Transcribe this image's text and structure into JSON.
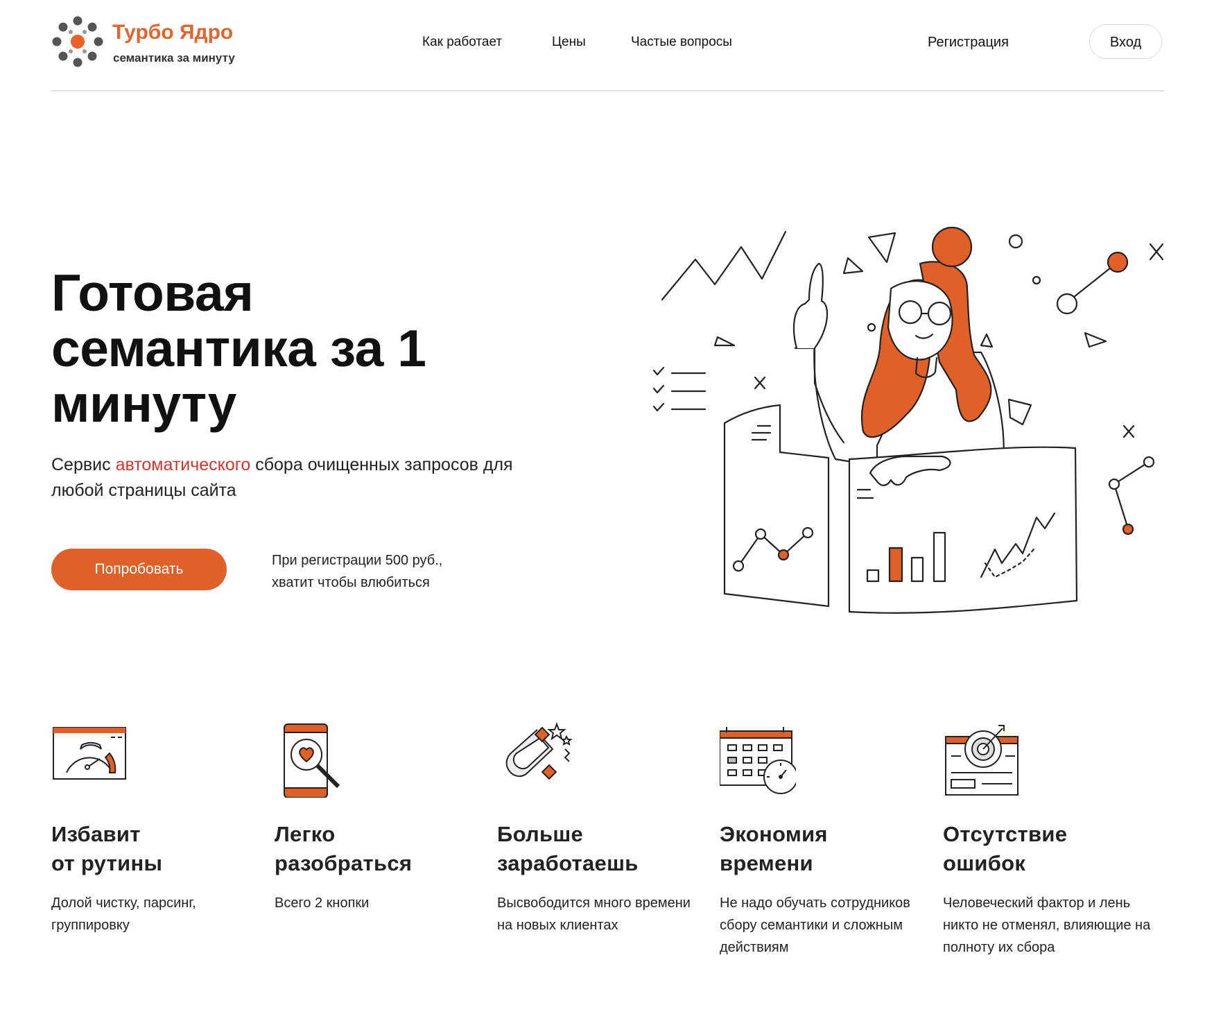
{
  "header": {
    "logo_title": "Турбо Ядро",
    "logo_subtitle": "семантика за минуту",
    "nav": [
      "Как работает",
      "Цены",
      "Частые вопросы"
    ],
    "register": "Регистрация",
    "login": "Вход"
  },
  "hero": {
    "title_line1": "Готовая",
    "title_line2": "семантика за 1",
    "title_line3": "минуту",
    "subtitle_before": "Сервис ",
    "subtitle_accent": "автоматического",
    "subtitle_after": " сбора очищенных запросов для любой страницы сайта",
    "cta": "Попробовать",
    "note_line1": "При регистрации 500 руб.,",
    "note_line2": "хватит чтобы влюбиться"
  },
  "features": [
    {
      "title_line1": "Избавит",
      "title_line2": "от рутины",
      "text": "Долой чистку, парсинг, группировку",
      "icon": "speedometer-icon"
    },
    {
      "title_line1": "Легко",
      "title_line2": "разобраться",
      "text": "Всего 2 кнопки",
      "icon": "phone-search-icon"
    },
    {
      "title_line1": "Больше",
      "title_line2": "заработаешь",
      "text": "Высвободится много времени на новых клиентах",
      "icon": "magnet-icon"
    },
    {
      "title_line1": "Экономия",
      "title_line2": "времени",
      "text": "Не надо обучать сотрудников сбору семантики и сложным действиям",
      "icon": "calendar-clock-icon"
    },
    {
      "title_line1": "Отсутствие",
      "title_line2": "ошибок",
      "text": "Человеческий фактор и лень никто не отменял, влияющие на полноту их сбора",
      "icon": "target-icon"
    }
  ],
  "colors": {
    "accent": "#df6129",
    "accent_text": "#d9342b",
    "divider": "#e4e4e4"
  }
}
